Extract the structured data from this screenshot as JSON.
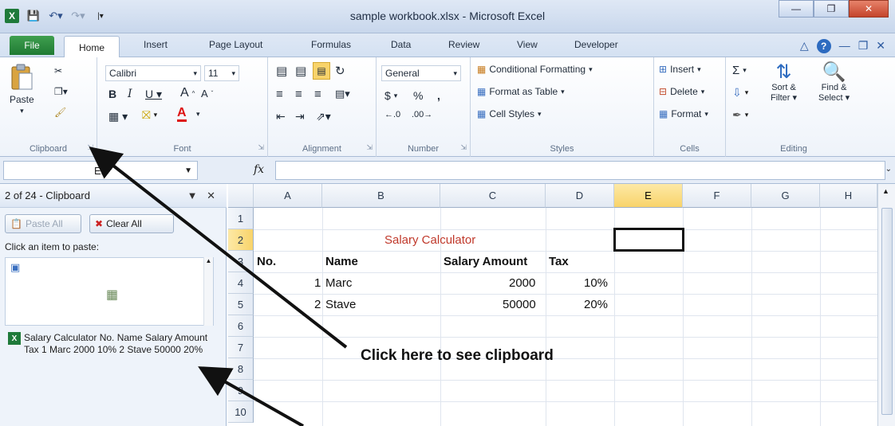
{
  "window": {
    "title": "sample workbook.xlsx - Microsoft Excel",
    "controls": [
      "minimize-icon",
      "restore-icon",
      "close-icon"
    ]
  },
  "tabs": [
    "File",
    "Home",
    "Insert",
    "Page Layout",
    "Formulas",
    "Data",
    "Review",
    "View",
    "Developer"
  ],
  "ribbon": {
    "clipboard": {
      "paste": "Paste",
      "label": "Clipboard"
    },
    "font": {
      "name": "Calibri",
      "size": "11",
      "label": "Font"
    },
    "alignment": {
      "label": "Alignment"
    },
    "number": {
      "format": "General",
      "currency": "$",
      "percent": "%",
      "comma": ",",
      "label": "Number"
    },
    "styles": {
      "conditional": "Conditional Formatting",
      "table": "Format as Table",
      "cell": "Cell Styles",
      "label": "Styles"
    },
    "cells": {
      "insert": "Insert",
      "delete": "Delete",
      "format": "Format",
      "label": "Cells"
    },
    "editing": {
      "sort1": "Sort &",
      "sort2": "Filter",
      "find1": "Find &",
      "find2": "Select",
      "label": "Editing"
    }
  },
  "formula_bar": {
    "name_box": "E2",
    "fx": "fx",
    "value": ""
  },
  "clipboard_pane": {
    "title": "2 of 24 - Clipboard",
    "paste_all": "Paste All",
    "clear_all": "Clear All",
    "instruction": "Click an item to paste:",
    "item_text": "Salary Calculator No. Name Salary Amount Tax 1 Marc 2000 10% 2 Stave 50000 20%"
  },
  "sheet": {
    "columns": [
      "A",
      "B",
      "C",
      "D",
      "E",
      "F",
      "G",
      "H"
    ],
    "rows": [
      "1",
      "2",
      "3",
      "4",
      "5",
      "6",
      "7",
      "8",
      "9",
      "10"
    ],
    "selected_cell": "E2",
    "title": "Salary Calculator",
    "headers": {
      "no": "No.",
      "name": "Name",
      "salary": "Salary Amount",
      "tax": "Tax"
    },
    "data": [
      {
        "no": "1",
        "name": "Marc",
        "salary": "2000",
        "tax": "10%"
      },
      {
        "no": "2",
        "name": "Stave",
        "salary": "50000",
        "tax": "20%"
      }
    ]
  },
  "annotation": "Click here to see clipboard",
  "colors": {
    "excel_green": "#1f7a3a",
    "title_red": "#c0392b",
    "selection_yellow": "#f8d36a"
  }
}
